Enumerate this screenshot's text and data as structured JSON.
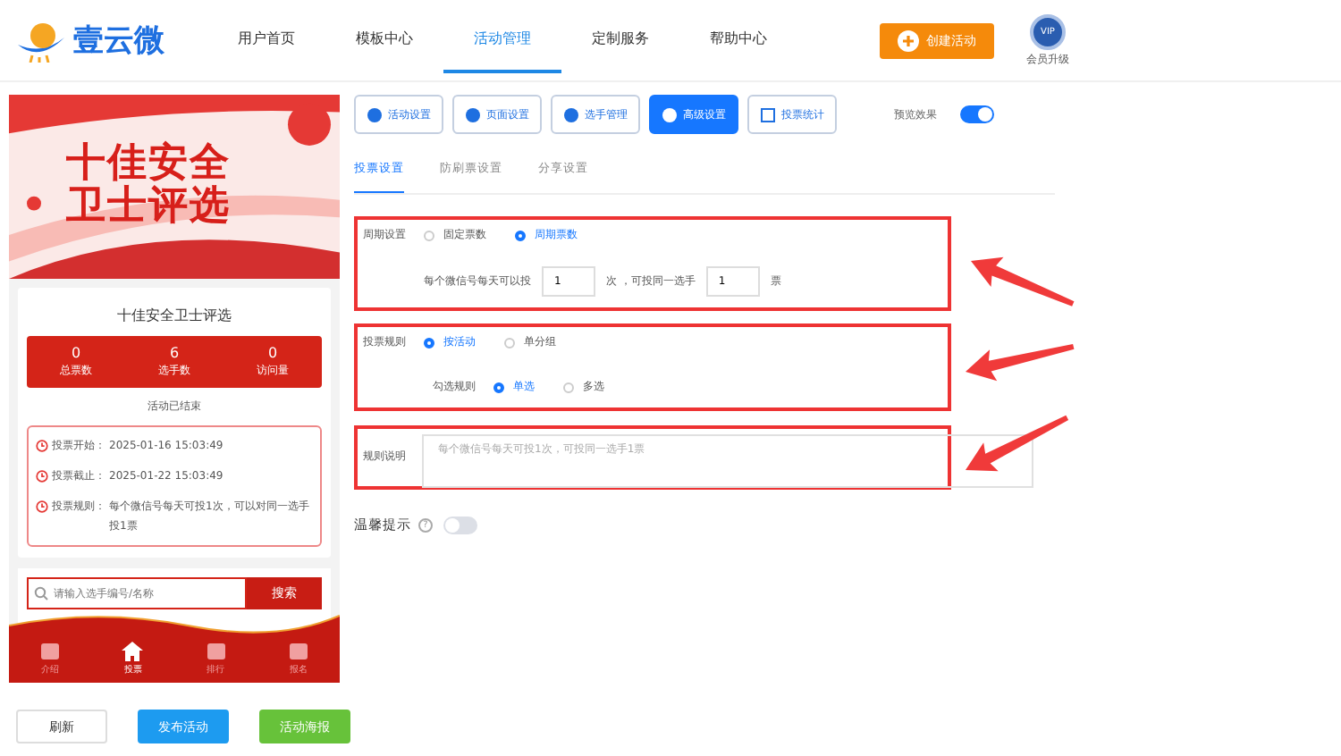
{
  "header": {
    "logo": "壹云微",
    "nav": [
      {
        "label": "用户首页",
        "selected": false
      },
      {
        "label": "模板中心",
        "selected": false
      },
      {
        "label": "活动管理",
        "selected": true
      },
      {
        "label": "定制服务",
        "selected": false
      },
      {
        "label": "帮助中心",
        "selected": false
      }
    ],
    "create_button": "创建活动",
    "vip_badge": "VIP",
    "vip_label": "会员升级"
  },
  "preview": {
    "banner_lines": [
      "十佳安全",
      "卫士评选"
    ],
    "title": "十佳安全卫士评选",
    "stats": [
      {
        "value": "0",
        "label": "总票数"
      },
      {
        "value": "6",
        "label": "选手数"
      },
      {
        "value": "0",
        "label": "访问量"
      }
    ],
    "status": "活动已结束",
    "info": [
      {
        "label": "投票开始：",
        "value": "2025-01-16 15:03:49"
      },
      {
        "label": "投票截止：",
        "value": "2025-01-22 15:03:49"
      },
      {
        "label": "投票规则：",
        "value": "每个微信号每天可投1次，可以对同一选手投1票"
      }
    ],
    "search_placeholder": "请输入选手编号/名称",
    "search_button": "搜索",
    "bottom_nav": [
      {
        "label": "介绍",
        "selected": false
      },
      {
        "label": "投票",
        "selected": true
      },
      {
        "label": "排行",
        "selected": false
      },
      {
        "label": "报名",
        "selected": false
      }
    ]
  },
  "actions": [
    {
      "label": "刷新",
      "kind": "plain"
    },
    {
      "label": "发布活动",
      "kind": "blue"
    },
    {
      "label": "活动海报",
      "kind": "green"
    }
  ],
  "toolbar": [
    {
      "label": "活动设置",
      "selected": false
    },
    {
      "label": "页面设置",
      "selected": false
    },
    {
      "label": "选手管理",
      "selected": false
    },
    {
      "label": "高级设置",
      "selected": true
    },
    {
      "label": "投票统计",
      "selected": false
    }
  ],
  "preview_toggle": {
    "label": "预览效果",
    "on": true
  },
  "subtabs": [
    {
      "label": "投票设置",
      "selected": true
    },
    {
      "label": "防刷票设置",
      "selected": false
    },
    {
      "label": "分享设置",
      "selected": false
    }
  ],
  "period": {
    "label": "周期设置",
    "options": [
      {
        "label": "固定票数",
        "selected": false
      },
      {
        "label": "周期票数",
        "selected": true
      }
    ],
    "text_before": "每个微信号每天可以投",
    "times": "1",
    "text_mid": "次 ，可投同一选手",
    "votes": "1",
    "text_after": "票"
  },
  "rule": {
    "label": "投票规则",
    "options": [
      {
        "label": "按活动",
        "selected": true
      },
      {
        "label": "单分组",
        "selected": false
      }
    ],
    "check_label": "勾选规则",
    "check_options": [
      {
        "label": "单选",
        "selected": true
      },
      {
        "label": "多选",
        "selected": false
      }
    ]
  },
  "description": {
    "label": "规则说明",
    "placeholder": "每个微信号每天可投1次，可投同一选手1票"
  },
  "tip": {
    "label": "温馨提示",
    "help": "?",
    "on": false
  }
}
